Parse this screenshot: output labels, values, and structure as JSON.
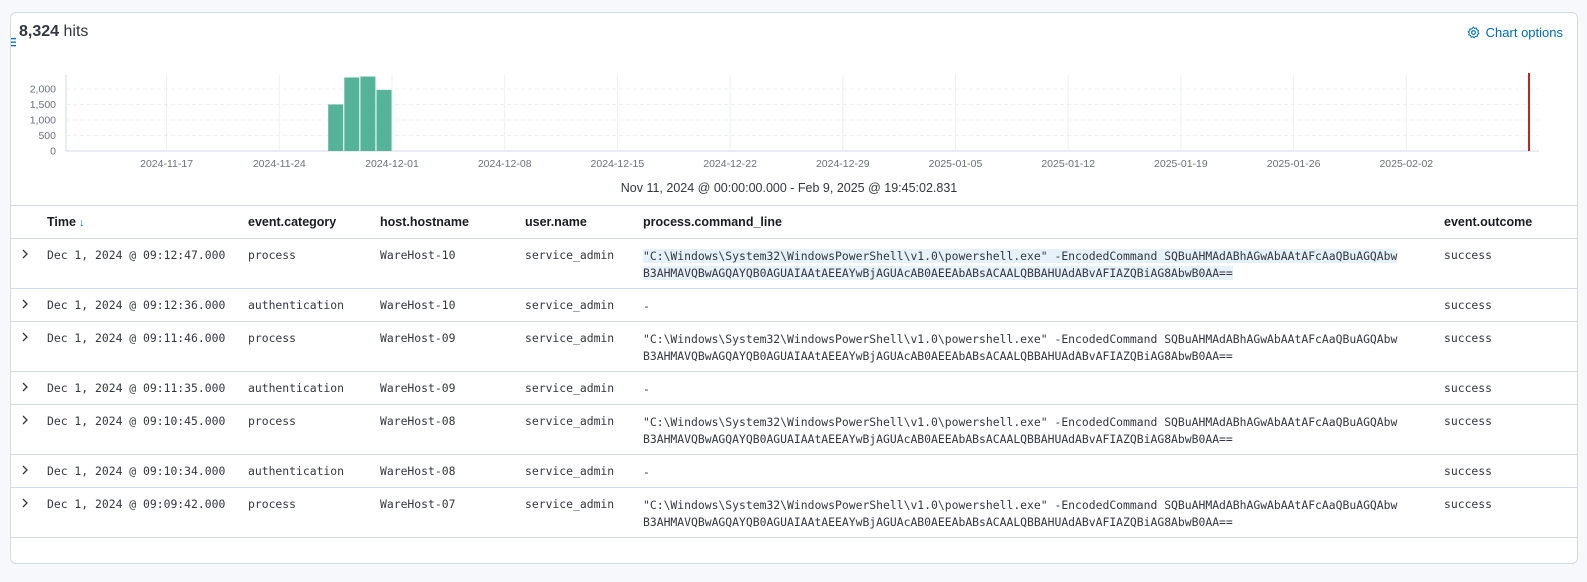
{
  "header": {
    "hits_count": "8,324",
    "hits_label": "hits",
    "chart_options_label": "Chart options"
  },
  "icons": {
    "menu": "list-icon",
    "chart_options": "gear-icon",
    "expand_row": "chevron-right-icon",
    "sort": "arrow-down-icon"
  },
  "colors": {
    "bar": "#54b399",
    "now_marker": "#bd271e",
    "link": "#006bb8"
  },
  "chart_data": {
    "type": "bar",
    "y_tick_labels": [
      "2,000",
      "1,500",
      "1,000",
      "500",
      "0"
    ],
    "y_ticks": [
      2000,
      1500,
      1000,
      500,
      0
    ],
    "ylim": [
      0,
      2450
    ],
    "x_tick_labels": [
      "2024-11-17",
      "2024-11-24",
      "2024-12-01",
      "2024-12-08",
      "2024-12-15",
      "2024-12-22",
      "2024-12-29",
      "2025-01-05",
      "2025-01-12",
      "2025-01-19",
      "2025-01-26",
      "2025-02-02"
    ],
    "bars": [
      {
        "date": "2024-11-28",
        "value": 1500
      },
      {
        "date": "2024-11-29",
        "value": 2370
      },
      {
        "date": "2024-11-30",
        "value": 2400
      },
      {
        "date": "2024-12-01",
        "value": 1970
      }
    ],
    "grid": true,
    "now_marker_date": "2025-02-09"
  },
  "time_range": "Nov 11, 2024 @ 00:00:00.000 - Feb 9, 2025 @ 19:45:02.831",
  "table": {
    "columns": [
      "Time",
      "event.category",
      "host.hostname",
      "user.name",
      "process.command_line",
      "event.outcome"
    ],
    "rows": [
      {
        "time": "Dec 1, 2024 @ 09:12:47.000",
        "category": "process",
        "host": "WareHost-10",
        "user": "service_admin",
        "cmd_line1": "\"C:\\Windows\\System32\\WindowsPowerShell\\v1.0\\powershell.exe\" -EncodedCommand SQBuAHMAdABhAGwAbAAtAFcAaQBuAGQAbw",
        "cmd_line2": "B3AHMAVQBwAGQAYQB0AGUAIAAtAEEAYwBjAGUAcAB0AEEAbABsACAALQBBAHUAdABvAFIAZQBiAG8AbwB0AA==",
        "outcome": "success"
      },
      {
        "time": "Dec 1, 2024 @ 09:12:36.000",
        "category": "authentication",
        "host": "WareHost-10",
        "user": "service_admin",
        "cmd_line1": " -",
        "cmd_line2": "",
        "outcome": "success"
      },
      {
        "time": "Dec 1, 2024 @ 09:11:46.000",
        "category": "process",
        "host": "WareHost-09",
        "user": "service_admin",
        "cmd_line1": "\"C:\\Windows\\System32\\WindowsPowerShell\\v1.0\\powershell.exe\" -EncodedCommand SQBuAHMAdABhAGwAbAAtAFcAaQBuAGQAbw",
        "cmd_line2": "B3AHMAVQBwAGQAYQB0AGUAIAAtAEEAYwBjAGUAcAB0AEEAbABsACAALQBBAHUAdABvAFIAZQBiAG8AbwB0AA==",
        "outcome": "success"
      },
      {
        "time": "Dec 1, 2024 @ 09:11:35.000",
        "category": "authentication",
        "host": "WareHost-09",
        "user": "service_admin",
        "cmd_line1": " -",
        "cmd_line2": "",
        "outcome": "success"
      },
      {
        "time": "Dec 1, 2024 @ 09:10:45.000",
        "category": "process",
        "host": "WareHost-08",
        "user": "service_admin",
        "cmd_line1": "\"C:\\Windows\\System32\\WindowsPowerShell\\v1.0\\powershell.exe\" -EncodedCommand SQBuAHMAdABhAGwAbAAtAFcAaQBuAGQAbw",
        "cmd_line2": "B3AHMAVQBwAGQAYQB0AGUAIAAtAEEAYwBjAGUAcAB0AEEAbABsACAALQBBAHUAdABvAFIAZQBiAG8AbwB0AA==",
        "outcome": "success"
      },
      {
        "time": "Dec 1, 2024 @ 09:10:34.000",
        "category": "authentication",
        "host": "WareHost-08",
        "user": "service_admin",
        "cmd_line1": " -",
        "cmd_line2": "",
        "outcome": "success"
      },
      {
        "time": "Dec 1, 2024 @ 09:09:42.000",
        "category": "process",
        "host": "WareHost-07",
        "user": "service_admin",
        "cmd_line1": "\"C:\\Windows\\System32\\WindowsPowerShell\\v1.0\\powershell.exe\" -EncodedCommand SQBuAHMAdABhAGwAbAAtAFcAaQBuAGQAbw",
        "cmd_line2": "B3AHMAVQBwAGQAYQB0AGUAIAAtAEEAYwBjAGUAcAB0AEEAbABsACAALQBBAHUAdABvAFIAZQBiAG8AbwB0AA==",
        "outcome": "success"
      }
    ]
  }
}
